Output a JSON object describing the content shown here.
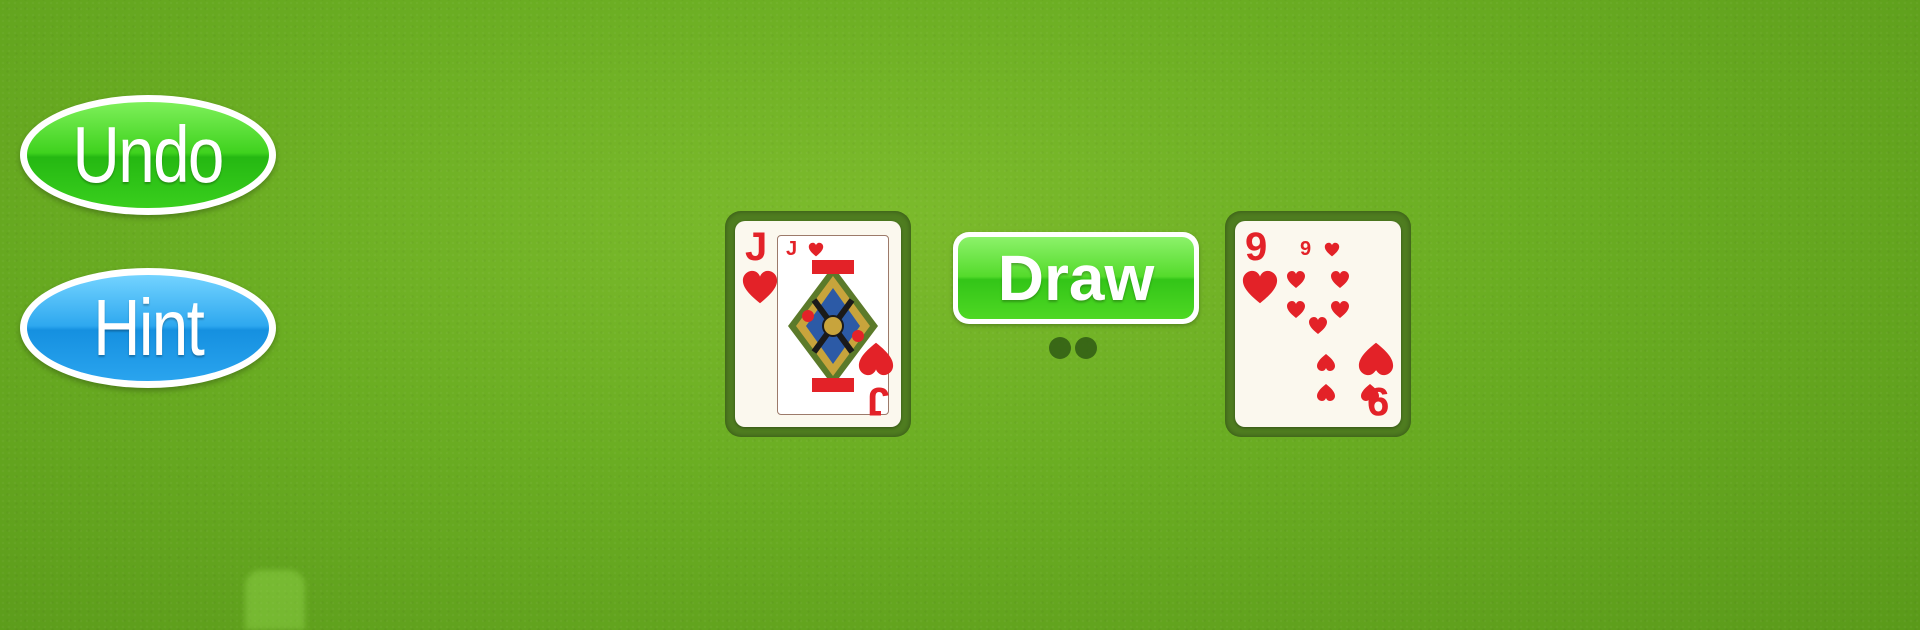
{
  "buttons": {
    "undo_label": "Undo",
    "hint_label": "Hint",
    "draw_label": "Draw"
  },
  "cards": {
    "left": {
      "rank": "J",
      "suit": "hearts",
      "color": "#e32228"
    },
    "right": {
      "rank": "9",
      "suit": "hearts",
      "color": "#e32228"
    }
  },
  "stock": {
    "remaining_indicator_dots": 2
  },
  "colors": {
    "felt": "#6aad22",
    "undo_green": "#3fd21e",
    "hint_blue": "#2ea8ef",
    "draw_green": "#55db2c",
    "suit_red": "#e32228"
  },
  "icons": [
    "heart-icon"
  ]
}
